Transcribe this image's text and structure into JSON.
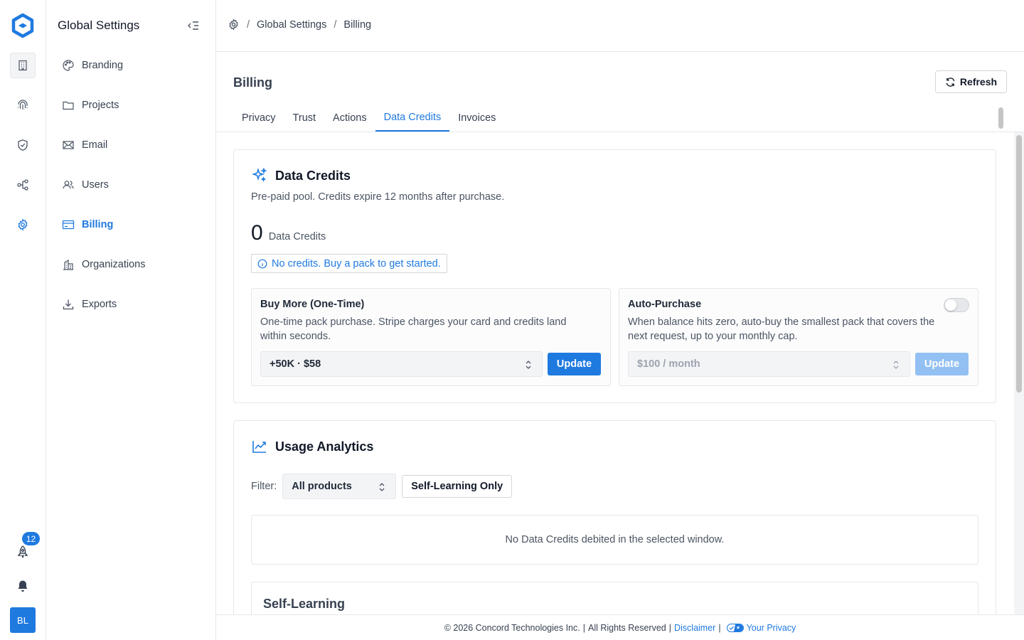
{
  "rail": {
    "items": [
      "buildings-icon",
      "fingerprint-icon",
      "shield-check-icon",
      "workflow-icon",
      "gear-icon"
    ],
    "badge_count": "12",
    "avatar_initials": "BL"
  },
  "sidebar": {
    "title": "Global Settings",
    "items": [
      {
        "label": "Branding",
        "icon": "palette-icon"
      },
      {
        "label": "Projects",
        "icon": "folder-icon"
      },
      {
        "label": "Email",
        "icon": "mail-icon"
      },
      {
        "label": "Users",
        "icon": "users-icon"
      },
      {
        "label": "Billing",
        "icon": "billing-icon",
        "active": true
      },
      {
        "label": "Organizations",
        "icon": "organizations-icon"
      },
      {
        "label": "Exports",
        "icon": "download-icon"
      }
    ]
  },
  "breadcrumb": {
    "items": [
      "Global Settings",
      "Billing"
    ],
    "separator": "/"
  },
  "page": {
    "title": "Billing",
    "refresh_label": "Refresh",
    "tabs": [
      "Privacy",
      "Trust",
      "Actions",
      "Data Credits",
      "Invoices"
    ],
    "active_tab": "Data Credits"
  },
  "data_credits": {
    "title": "Data Credits",
    "description": "Pre-paid pool. Credits expire 12 months after purchase.",
    "balance": "0",
    "balance_unit": "Data Credits",
    "notice": "No credits. Buy a pack to get started.",
    "buy_more": {
      "title": "Buy More (One-Time)",
      "description": "One-time pack purchase. Stripe charges your card and credits land within seconds.",
      "selected": "+50K · $58",
      "button": "Update"
    },
    "auto_purchase": {
      "title": "Auto-Purchase",
      "description": "When balance hits zero, auto-buy the smallest pack that covers the next request, up to your monthly cap.",
      "enabled": false,
      "selected": "$100 / month",
      "button": "Update"
    }
  },
  "usage": {
    "title": "Usage Analytics",
    "filter_label": "Filter:",
    "filter_value": "All products",
    "self_learning_button": "Self-Learning Only",
    "empty_message": "No Data Credits debited in the selected window.",
    "section_title": "Self-Learning"
  },
  "footer": {
    "copyright": "© 2026 Concord Technologies Inc.",
    "sep1": "|",
    "rights": "All Rights Reserved",
    "sep2": "|",
    "disclaimer": "Disclaimer",
    "sep3": "|",
    "privacy": "Your Privacy"
  },
  "colors": {
    "accent": "#1f7ae0",
    "border": "#e5e7eb",
    "muted_text": "#4b5563"
  }
}
